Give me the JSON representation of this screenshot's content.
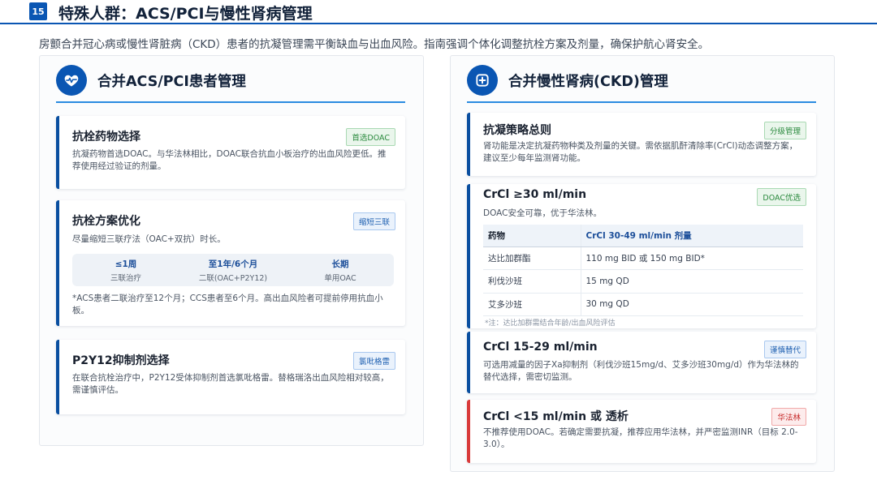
{
  "header": {
    "page_number": "15",
    "title": "特殊人群：ACS/PCI与慢性肾病管理"
  },
  "subtitle": "房颤合并冠心病或慢性肾脏病（CKD）患者的抗凝管理需平衡缺血与出血风险。指南强调个体化调整抗栓方案及剂量，确保护航心肾安全。",
  "left_panel": {
    "title": "合并ACS/PCI患者管理",
    "icon": "heart-pulse-icon",
    "cards": [
      {
        "title": "抗栓药物选择",
        "badge": "首选DOAC",
        "text": "抗凝药物首选DOAC。与华法林相比，DOAC联合抗血小板治疗的出血风险更低。推荐使用经过验证的剂量。"
      },
      {
        "title": "抗栓方案优化",
        "badge": "缩短三联",
        "text": "尽量缩短三联疗法（OAC+双抗）时长。",
        "timeline": [
          {
            "main": "≤1周",
            "sub": "三联治疗"
          },
          {
            "main": "至1年/6个月",
            "sub": "二联(OAC+P2Y12)"
          },
          {
            "main": "长期",
            "sub": "单用OAC"
          }
        ],
        "footnote": "*ACS患者二联治疗至12个月；CCS患者至6个月。高出血风险者可提前停用抗血小板。"
      },
      {
        "title": "P2Y12抑制剂选择",
        "badge": "氯吡格雷",
        "text": "在联合抗栓治疗中，P2Y12受体抑制剂首选氯吡格雷。替格瑞洛出血风险相对较高，需谨慎评估。"
      }
    ]
  },
  "right_panel": {
    "title": "合并慢性肾病(CKD)管理",
    "icon": "medical-plus-icon",
    "cards": [
      {
        "title": "抗凝策略总则",
        "badge": "分级管理",
        "text": "肾功能是决定抗凝药物种类及剂量的关键。需依据肌酐清除率(CrCl)动态调整方案，建议至少每年监测肾功能。"
      },
      {
        "title": "CrCl ≥30 ml/min",
        "badge": "DOAC优选",
        "text": "DOAC安全可靠，优于华法林。",
        "table": {
          "headers": [
            "药物",
            "CrCl 30-49 ml/min 剂量"
          ],
          "rows": [
            [
              "达比加群酯",
              "110 mg BID 或 150 mg BID*"
            ],
            [
              "利伐沙班",
              "15 mg QD"
            ],
            [
              "艾多沙班",
              "30 mg QD"
            ]
          ]
        },
        "note": "*注：达比加群需结合年龄/出血风险评估"
      },
      {
        "title": "CrCl 15-29 ml/min",
        "badge": "谨慎替代",
        "text": "可选用减量的因子Xa抑制剂（利伐沙班15mg/d、艾多沙班30mg/d）作为华法林的替代选择，需密切监测。"
      },
      {
        "title": "CrCl <15 ml/min 或 透析",
        "badge": "华法林",
        "text": "不推荐使用DOAC。若确定需要抗凝，推荐应用华法林，并严密监测INR（目标 2.0-3.0）。"
      }
    ]
  }
}
